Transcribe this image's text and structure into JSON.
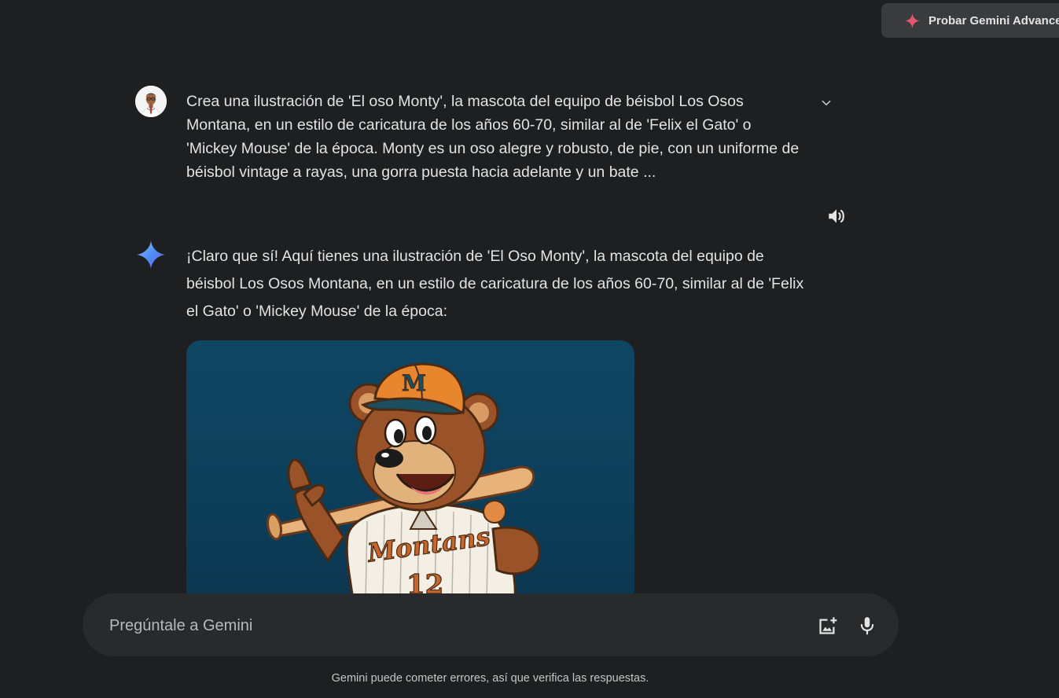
{
  "header": {
    "upgrade_label": "Probar Gemini Advance"
  },
  "conversation": {
    "user_prompt": "Crea una ilustración de 'El oso Monty', la mascota del equipo de béisbol Los Osos Montana, en un estilo de caricatura de los años 60-70, similar al de 'Felix el Gato' o 'Mickey Mouse' de la época. Monty es un oso alegre y robusto, de pie, con un uniforme de béisbol vintage a rayas, una gorra puesta hacia adelante y un bate ...",
    "response_text": "¡Claro que sí! Aquí tienes una ilustración de 'El Oso Monty', la mascota del equipo de béisbol Los Osos Montana, en un estilo de caricatura de los años 60-70, similar al de 'Felix el Gato' o 'Mickey Mouse' de la época:",
    "image": {
      "cap_letter": "M",
      "jersey_text": "Montans",
      "jersey_number": "12"
    }
  },
  "input": {
    "placeholder": "Pregúntale a Gemini"
  },
  "footer": {
    "disclaimer": "Gemini puede cometer errores, así que verifica las respuestas."
  },
  "icons": {
    "upgrade": "sparkle-icon",
    "expand": "chevron-down-icon",
    "speak": "speaker-icon",
    "assistant": "gemini-sparkle-icon",
    "add_image": "add-image-icon",
    "mic": "microphone-icon"
  },
  "colors": {
    "background": "#1e1f20",
    "input_background": "#282a2c",
    "text": "#e3e3e3",
    "upgrade_spark": "#e2566e",
    "gemini_blue": "#4e8df5",
    "image_background": "#0f4663",
    "cap_orange": "#e8862e",
    "bear_brown": "#9a5328"
  }
}
